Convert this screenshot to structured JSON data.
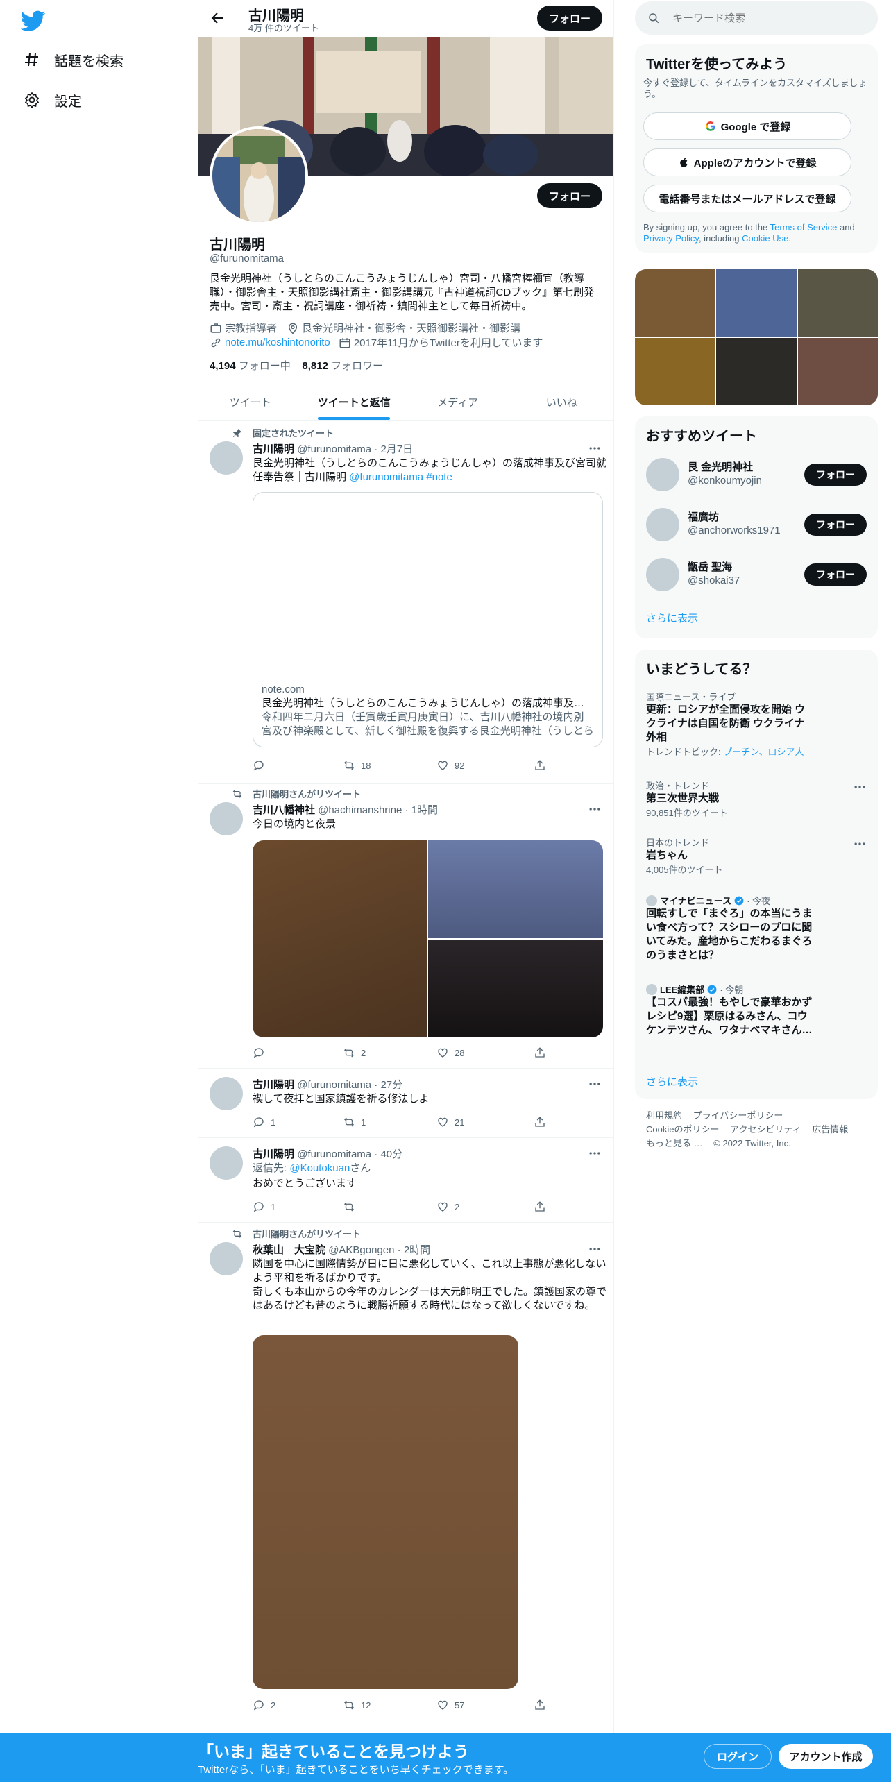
{
  "nav": {
    "explore_label": "話題を検索",
    "settings_label": "設定"
  },
  "header": {
    "name": "古川陽明",
    "tweet_count": "4万 件のツイート",
    "follow_label": "フォロー"
  },
  "profile": {
    "name": "古川陽明",
    "handle": "@furunomitama",
    "bio": "艮金光明神社（うしとらのこんこうみょうじんしゃ）宮司・八幡宮権禰宜（教導職）・御影舎主・天照御影講社斎主・御影講講元『古神道祝詞CDブック』第七刷発売中。宮司・斎主・祝詞講座・御祈祷・鎮問神主として毎日祈祷中。",
    "category": "宗教指導者",
    "location": "艮金光明神社・御影舎・天照御影講社・御影講",
    "url": "note.mu/koshintonorito",
    "joined": "2017年11月からTwitterを利用しています",
    "following_count": "4,194",
    "following_label": "フォロー中",
    "followers_count": "8,812",
    "followers_label": "フォロワー",
    "follow_label": "フォロー"
  },
  "tabs": [
    {
      "label": "ツイート"
    },
    {
      "label": "ツイートと返信"
    },
    {
      "label": "メディア"
    },
    {
      "label": "いいね"
    }
  ],
  "tweets": [
    {
      "context": "固定されたツイート",
      "name": "古川陽明",
      "handle": "@furunomitama",
      "time": "· 2月7日",
      "text": "艮金光明神社（うしとらのこんこうみょうじんしゃ）の落成神事及び宮司就任奉告祭｜古川陽明 ",
      "mention": "@furunomitama",
      "hashtag": "#note",
      "card_domain": "note.com",
      "card_title": "艮金光明神社（うしとらのこんこうみょうじんしゃ）の落成神事及び宮司就任奉告祭｜古川陽明",
      "card_desc": "令和四年二月六日（壬寅歳壬寅月庚寅日）に、吉川八幡神社の境内別宮及び神楽殿として、新しく御社殿を復興する艮金光明神社（うしとらのこんこうみょうじんしゃ）の落成神事",
      "replies": "",
      "retweets": "18",
      "likes": "92"
    },
    {
      "context": "古川陽明さんがリツイート",
      "name": "吉川八幡神社",
      "handle": "@hachimanshrine",
      "time": "· 1時間",
      "text": "今日の境内と夜景",
      "replies": "",
      "retweets": "2",
      "likes": "28"
    },
    {
      "name": "古川陽明",
      "handle": "@furunomitama",
      "time": "· 27分",
      "text": "禊して夜拝と国家鎮護を祈る修法しよ",
      "replies": "1",
      "retweets": "1",
      "likes": "21"
    },
    {
      "name": "古川陽明",
      "handle": "@furunomitama",
      "time": "· 40分",
      "reply_prefix": "返信先: ",
      "reply_to": "@Koutokuan",
      "reply_suffix": "さん",
      "text": "おめでとうございます",
      "replies": "1",
      "retweets": "",
      "likes": "2"
    },
    {
      "context": "古川陽明さんがリツイート",
      "name": "秋葉山　大宝院",
      "handle": "@AKBgongen",
      "time": "· 2時間",
      "text": "隣国を中心に国際情勢が日に日に悪化していく、これ以上事態が悪化しないよう平和を祈るばかりです。",
      "text2": "奇しくも本山からの今年のカレンダーは大元帥明王でした。鎮護国家の尊ではあるけども昔のように戦勝祈願する時代にはなって欲しくないですね。",
      "replies": "2",
      "retweets": "12",
      "likes": "57"
    }
  ],
  "search": {
    "placeholder": "キーワード検索"
  },
  "signup": {
    "title": "Twitterを使ってみよう",
    "subtitle": "今すぐ登録して、タイムラインをカスタマイズしましょう。",
    "google": "Google で登録",
    "apple": "Appleのアカウントで登録",
    "phone": "電話番号またはメールアドレスで登録",
    "terms_prefix": "By signing up, you agree to the ",
    "terms_link": "Terms of Service",
    "terms_and": " and ",
    "privacy_link": "Privacy Policy",
    "terms_including": ", including ",
    "cookie_link": "Cookie Use",
    "terms_end": "."
  },
  "who_to_follow": {
    "title": "おすすめツイート",
    "items": [
      {
        "name": "艮 金光明神社",
        "handle": "@konkoumyojin",
        "button": "フォロー"
      },
      {
        "name": "福廣坊",
        "handle": "@anchorworks1971",
        "button": "フォロー"
      },
      {
        "name": "甑岳 聖海",
        "handle": "@shokai37",
        "button": "フォロー"
      }
    ],
    "more": "さらに表示"
  },
  "trends": {
    "title": "いまどうしてる？",
    "items": [
      {
        "context": "国際ニュース・ライブ",
        "title": "更新：ロシアが全面侵攻を開始 ウクライナは自国を防衛 ウクライナ外相",
        "topic_prefix": "トレンドトピック: ",
        "topic_links": "プーチン、ロシア人"
      },
      {
        "context": "政治・トレンド",
        "title": "第三次世界大戦",
        "count": "90,851件のツイート"
      },
      {
        "context": "日本のトレンド",
        "title": "岩ちゃん",
        "count": "4,005件のツイート"
      },
      {
        "source": "マイナビニュース",
        "time": "· 今夜",
        "title": "回転すしで「まぐろ」の本当にうまい食べ方って？スシローのプロに聞いてみた。産地からこだわるまぐろのうまさとは？"
      },
      {
        "source": "LEE編集部",
        "time": "· 今朝",
        "title": "【コスパ最強！もやしで豪華おかずレシピ9選】栗原はるみさん、コウケンテツさん、ワタナベマキさん…"
      }
    ],
    "more": "さらに表示"
  },
  "footer": {
    "links": [
      "利用規約",
      "プライバシーポリシー",
      "Cookieのポリシー",
      "アクセシビリティ",
      "広告情報",
      "もっと見る …"
    ],
    "copyright": "© 2022 Twitter, Inc."
  },
  "bottom_bar": {
    "title": "「いま」起きていることを見つけよう",
    "subtitle": "Twitterなら、「いま」起きていることをいち早くチェックできます。",
    "login": "ログイン",
    "signup": "アカウント作成"
  },
  "colors": {
    "accent": "#1d9bf0",
    "text": "#0f1419",
    "secondary_text": "#536471",
    "bottom_bar": "#1d9bf0",
    "panel": "#f7f9f9"
  },
  "icons": {
    "logo": "twitter-bird-icon",
    "explore": "hashtag-icon",
    "settings": "gear-icon",
    "back": "arrow-left-icon",
    "search": "search-icon"
  }
}
